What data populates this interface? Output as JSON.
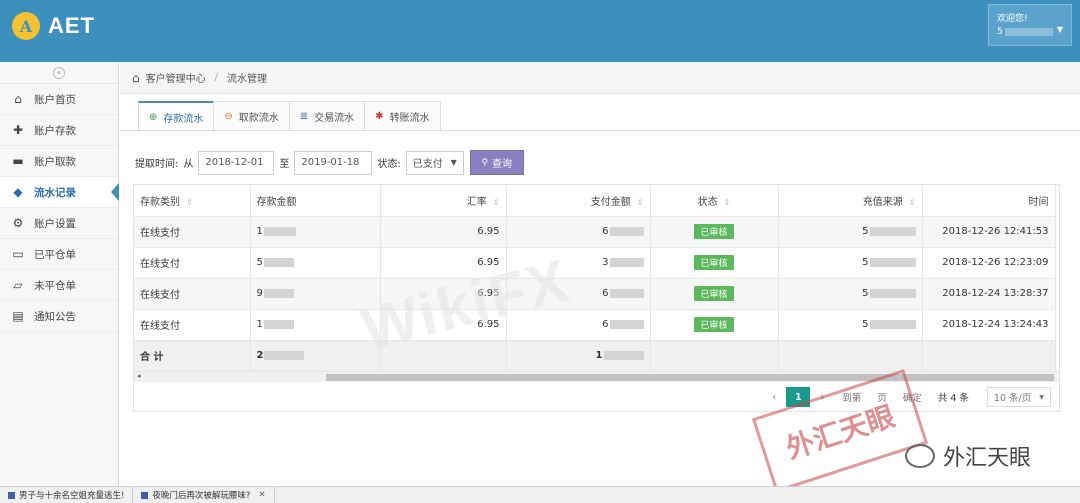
{
  "header": {
    "logo_letter": "A",
    "app_name": "AET",
    "welcome": "欢迎您!",
    "user_prefix": "5",
    "caret_icon": "chevron-down-icon"
  },
  "sidebar": {
    "collapse_icon": "«",
    "items": [
      {
        "label": "账户首页",
        "icon": "home-icon",
        "glyph": "⌂"
      },
      {
        "label": "账户存款",
        "icon": "plus-icon",
        "glyph": "✚"
      },
      {
        "label": "账户取款",
        "icon": "minus-icon",
        "glyph": "▬"
      },
      {
        "label": "流水记录",
        "icon": "tags-icon",
        "glyph": "◆"
      },
      {
        "label": "账户设置",
        "icon": "gears-icon",
        "glyph": "⚙"
      },
      {
        "label": "已平仓单",
        "icon": "folder-icon",
        "glyph": "▭"
      },
      {
        "label": "未平仓单",
        "icon": "folder-open-icon",
        "glyph": "▱"
      },
      {
        "label": "通知公告",
        "icon": "calendar-icon",
        "glyph": "▤"
      }
    ]
  },
  "breadcrumb": {
    "home_glyph": "⌂",
    "root": "客户管理中心",
    "sep": "/",
    "current": "流水管理"
  },
  "tabs": [
    {
      "label": "存款流水",
      "glyph": "⊕",
      "color": "#3c9a4e"
    },
    {
      "label": "取款流水",
      "glyph": "⊖",
      "color": "#d9742a"
    },
    {
      "label": "交易流水",
      "glyph": "≣",
      "color": "#3d6fb0"
    },
    {
      "label": "转账流水",
      "glyph": "✱",
      "color": "#c0392b"
    }
  ],
  "filter": {
    "label_time": "提取时间:",
    "from": "从",
    "date_from": "2018-12-01",
    "to": "至",
    "date_to": "2019-01-18",
    "label_status": "状态:",
    "status_value": "已支付",
    "search_glyph": "🔍",
    "search_label": "查询"
  },
  "table": {
    "columns": [
      "存款类别",
      "存款金额",
      "汇率",
      "支付金额",
      "状态",
      "充值来源",
      "时间"
    ],
    "sort_glyph": "⇕",
    "rows": [
      {
        "type": "在线支付",
        "amount_prefix": "1",
        "rate": "6.95",
        "pay_prefix": "6",
        "status": "已审核",
        "source_prefix": "5",
        "time": "2018-12-26 12:41:53"
      },
      {
        "type": "在线支付",
        "amount_prefix": "5",
        "rate": "6.95",
        "pay_prefix": "3",
        "status": "已审核",
        "source_prefix": "5",
        "time": "2018-12-26 12:23:09"
      },
      {
        "type": "在线支付",
        "amount_prefix": "9",
        "rate": "6.95",
        "pay_prefix": "6",
        "status": "已审核",
        "source_prefix": "5",
        "time": "2018-12-24 13:28:37"
      },
      {
        "type": "在线支付",
        "amount_prefix": "1",
        "rate": "6.95",
        "pay_prefix": "6",
        "status": "已审核",
        "source_prefix": "5",
        "time": "2018-12-24 13:24:43"
      }
    ],
    "total": {
      "label": "合 计",
      "amount_prefix": "2",
      "pay_prefix": "1"
    },
    "scroll_left": "◂"
  },
  "pager": {
    "prev": "‹",
    "current": "1",
    "next": "›",
    "goto": "到第",
    "page_unit": "页",
    "confirm": "确定",
    "total": "共 4 条",
    "per_page": "10 条/页",
    "per_caret": "▾"
  },
  "watermarks": {
    "stamp": "外汇天眼",
    "brand": "外汇天眼",
    "wikifx": "WikiFX"
  },
  "bottombar": {
    "items": [
      "男子与十余名空姐充量逃生!",
      "夜晚门后再次被解玩腰味?"
    ],
    "close": "✕"
  }
}
